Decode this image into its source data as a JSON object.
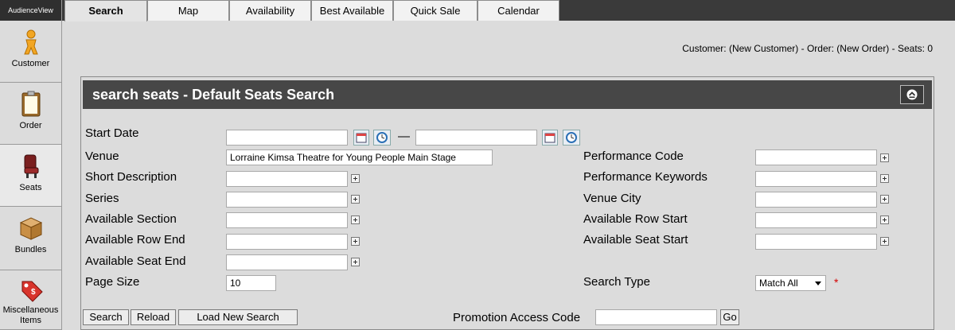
{
  "app": {
    "brand": "AudienceView"
  },
  "sidebar": {
    "items": [
      {
        "label": "Customer",
        "icon": "customer-icon"
      },
      {
        "label": "Order",
        "icon": "order-icon"
      },
      {
        "label": "Seats",
        "icon": "seats-icon"
      },
      {
        "label": "Bundles",
        "icon": "bundles-icon"
      },
      {
        "label": "Miscellaneous Items",
        "icon": "misc-items-icon"
      }
    ],
    "active": "Seats"
  },
  "tabs": [
    "Search",
    "Map",
    "Availability",
    "Best Available",
    "Quick Sale",
    "Calendar"
  ],
  "active_tab": "Search",
  "customer_info": "Customer: (New Customer) - Order: (New Order) - Seats: 0",
  "panel": {
    "title": "search seats - Default Seats Search",
    "fields": {
      "start_date": {
        "label": "Start Date",
        "from": "",
        "to": ""
      },
      "venue": {
        "label": "Venue",
        "value": "Lorraine Kimsa Theatre for Young People Main Stage"
      },
      "short_description": {
        "label": "Short Description",
        "value": ""
      },
      "series": {
        "label": "Series",
        "value": ""
      },
      "available_section": {
        "label": "Available Section",
        "value": ""
      },
      "available_row_end": {
        "label": "Available Row End",
        "value": ""
      },
      "available_seat_end": {
        "label": "Available Seat End",
        "value": ""
      },
      "page_size": {
        "label": "Page Size",
        "value": "10"
      },
      "performance_code": {
        "label": "Performance Code",
        "value": ""
      },
      "performance_keywords": {
        "label": "Performance Keywords",
        "value": ""
      },
      "venue_city": {
        "label": "Venue City",
        "value": ""
      },
      "available_row_start": {
        "label": "Available Row Start",
        "value": ""
      },
      "available_seat_start": {
        "label": "Available Seat Start",
        "value": ""
      },
      "search_type": {
        "label": "Search Type",
        "value": "Match All",
        "required_mark": "*"
      }
    },
    "buttons": {
      "search": "Search",
      "reload": "Reload",
      "load_new_search": "Load New Search",
      "go": "Go"
    },
    "promotion": {
      "label": "Promotion Access Code",
      "value": ""
    }
  },
  "colors": {
    "header_bg": "#474747",
    "tab_bar_bg": "#3a3a3a",
    "required": "#d40000"
  }
}
